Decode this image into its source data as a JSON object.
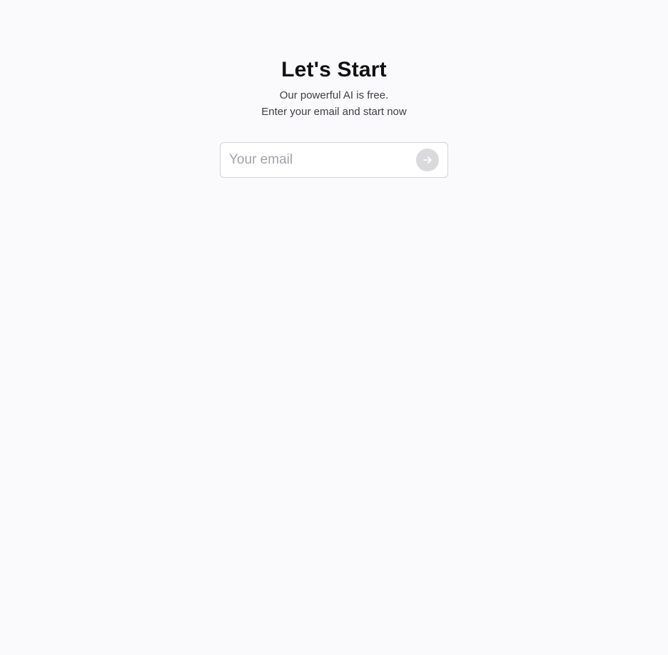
{
  "hero": {
    "title": "Let's Start",
    "subtitle_line1": "Our powerful AI is free.",
    "subtitle_line2": "Enter your email and start now"
  },
  "email_form": {
    "placeholder": "Your email",
    "value": "",
    "submit_icon": "arrow-right-icon"
  },
  "colors": {
    "background": "#fafafc",
    "title": "#111111",
    "subtitle": "#3f3f46",
    "input_border": "#d4d4d8",
    "placeholder": "#a1a1aa",
    "submit_bg": "#dadadd",
    "submit_icon": "#ffffff"
  }
}
